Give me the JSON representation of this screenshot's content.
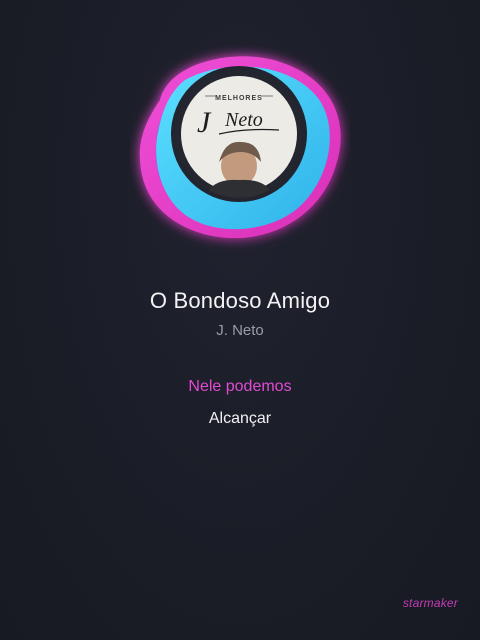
{
  "album": {
    "badge_text": "MELHORES",
    "logo_text_j": "J",
    "logo_text_name": "Neto"
  },
  "song": {
    "title": "O Bondoso Amigo",
    "artist": "J. Neto"
  },
  "lyrics": {
    "current_line": "Nele podemos",
    "next_line": "Alcançar"
  },
  "brand": {
    "watermark": "starmaker"
  },
  "colors": {
    "background": "#1b1e28",
    "lyric_highlight": "#e14bd2",
    "blob_cyan": "#3fd3f2",
    "blob_magenta": "#e83bd6",
    "blob_purple": "#8a5cf0"
  }
}
